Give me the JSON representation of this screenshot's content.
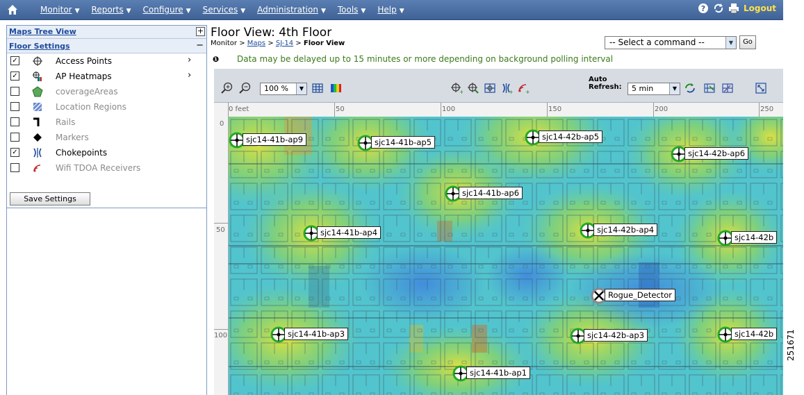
{
  "nav": {
    "menu": [
      "Monitor",
      "Reports",
      "Configure",
      "Services",
      "Administration",
      "Tools",
      "Help"
    ],
    "underline": [
      "M",
      "R",
      "C",
      "S",
      "A",
      "T",
      "H"
    ],
    "logout": "Logout"
  },
  "sidebar": {
    "tree_view_label": "Maps Tree View",
    "floor_settings_label": "Floor Settings",
    "layers": [
      {
        "label": "Access Points",
        "checked": true,
        "icon": "access-point-icon",
        "has_arrow": true,
        "dim": false
      },
      {
        "label": "AP Heatmaps",
        "checked": true,
        "icon": "heatmap-icon",
        "has_arrow": true,
        "dim": false
      },
      {
        "label": "coverageAreas",
        "checked": false,
        "icon": "coverage-area-icon",
        "has_arrow": false,
        "dim": true
      },
      {
        "label": "Location Regions",
        "checked": false,
        "icon": "location-region-icon",
        "has_arrow": false,
        "dim": true
      },
      {
        "label": "Rails",
        "checked": false,
        "icon": "rail-icon",
        "has_arrow": false,
        "dim": true
      },
      {
        "label": "Markers",
        "checked": false,
        "icon": "marker-icon",
        "has_arrow": false,
        "dim": true
      },
      {
        "label": "Chokepoints",
        "checked": true,
        "icon": "chokepoint-icon",
        "has_arrow": false,
        "dim": false
      },
      {
        "label": "Wifi TDOA Receivers",
        "checked": false,
        "icon": "wifi-tdoa-icon",
        "has_arrow": false,
        "dim": true
      }
    ],
    "save_label": "Save Settings"
  },
  "header": {
    "title": "Floor View:  4th Floor",
    "crumb_monitor": "Monitor",
    "crumb_sep": " > ",
    "crumb_maps": "Maps",
    "crumb_site": "SJ-14",
    "crumb_current": "Floor View",
    "command_placeholder": "-- Select a command --",
    "go_label": "Go",
    "notice": "Data may be delayed up to 15 minutes or more depending on background polling interval"
  },
  "toolbar": {
    "zoom": "100 %",
    "auto_refresh_line1": "Auto",
    "auto_refresh_line2": "Refresh:",
    "refresh_value": "5 min"
  },
  "ruler": {
    "x_ticks": [
      "0 feet",
      "50",
      "100",
      "150",
      "200",
      "250"
    ],
    "y_ticks": [
      "0",
      "50",
      "100"
    ]
  },
  "access_points": [
    {
      "name": "sjc14-41b-ap9",
      "type": "ap"
    },
    {
      "name": "sjc14-41b-ap5",
      "type": "ap"
    },
    {
      "name": "sjc14-42b-ap5",
      "type": "ap"
    },
    {
      "name": "sjc14-42b-ap6",
      "type": "ap"
    },
    {
      "name": "sjc14-41b-ap6",
      "type": "ap"
    },
    {
      "name": "sjc14-41b-ap4",
      "type": "ap"
    },
    {
      "name": "sjc14-42b-ap4",
      "type": "ap"
    },
    {
      "name": "sjc14-42b",
      "type": "ap"
    },
    {
      "name": "Rogue_Detector",
      "type": "rogue"
    },
    {
      "name": "sjc14-41b-ap3",
      "type": "ap"
    },
    {
      "name": "sjc14-42b-ap3",
      "type": "ap"
    },
    {
      "name": "sjc14-42b",
      "type": "ap"
    },
    {
      "name": "sjc14-41b-ap1",
      "type": "ap"
    }
  ],
  "figure_number": "251671",
  "colors": {
    "nav_bg": "#4a6fa5",
    "notice": "#3a7a1a",
    "logout": "#ffe24a",
    "ap_ring": "#22aa22",
    "rogue_ring": "#888888"
  }
}
